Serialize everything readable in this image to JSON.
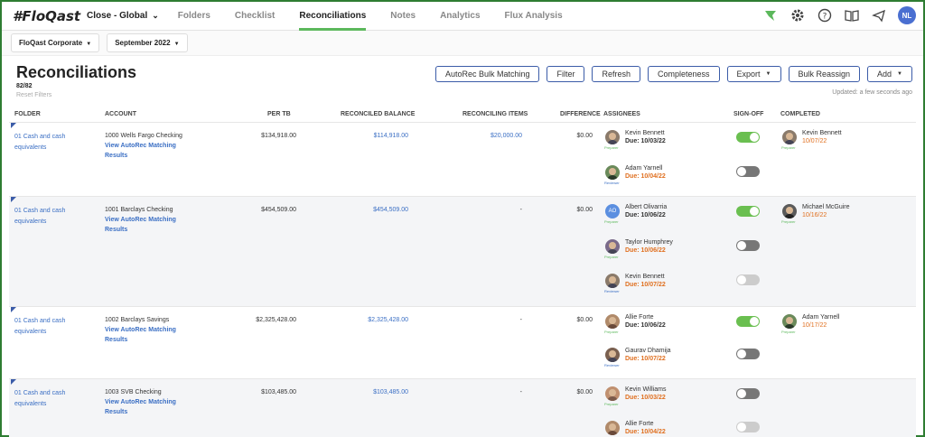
{
  "nav": {
    "logo": "#FloQast",
    "period": "Close - Global",
    "items": [
      "Folders",
      "Checklist",
      "Reconciliations",
      "Notes",
      "Analytics",
      "Flux Analysis"
    ],
    "user_initials": "NL"
  },
  "filters": {
    "entity": "FloQast Corporate",
    "month": "September 2022"
  },
  "page": {
    "title": "Reconciliations",
    "count": "82/82",
    "reset": "Reset Filters",
    "updated": "Updated: a few seconds ago",
    "buttons": [
      "AutoRec Bulk Matching",
      "Filter",
      "Refresh",
      "Completeness",
      "Export",
      "Bulk Reassign",
      "Add"
    ]
  },
  "columns": [
    "FOLDER",
    "ACCOUNT",
    "PER TB",
    "RECONCILED BALANCE",
    "RECONCILING ITEMS",
    "DIFFERENCE",
    "ASSIGNEES",
    "SIGN-OFF",
    "COMPLETED"
  ],
  "link_text": {
    "view": "View AutoRec Matching",
    "results": "Results"
  },
  "rows": [
    {
      "folder_line1": "01 Cash and cash",
      "folder_line2": "equivalents",
      "account": "1000 Wells Fargo Checking",
      "per_tb": "$134,918.00",
      "reconciled": "$114,918.00",
      "reconciling": "$20,000.00",
      "difference": "$0.00",
      "assignees": [
        {
          "name": "Kevin Bennett",
          "due": "Due: 10/03/22",
          "role": "Preparer",
          "signed": true
        },
        {
          "name": "Adam Yarnell",
          "due": "Due: 10/04/22",
          "role": "Reviewer",
          "signed": false
        }
      ],
      "completed": [
        {
          "name": "Kevin Bennett",
          "date": "10/07/22",
          "role": "Preparer"
        }
      ]
    },
    {
      "folder_line1": "01 Cash and cash",
      "folder_line2": "equivalents",
      "account": "1001 Barclays Checking",
      "per_tb": "$454,509.00",
      "reconciled": "$454,509.00",
      "reconciling": "-",
      "difference": "$0.00",
      "assignees": [
        {
          "name": "Albert Olivarria",
          "due": "Due: 10/06/22",
          "role": "Preparer",
          "signed": true,
          "initials": "AO"
        },
        {
          "name": "Taylor Humphrey",
          "due": "Due: 10/06/22",
          "role": "Preparer",
          "signed": false
        },
        {
          "name": "Kevin Bennett",
          "due": "Due: 10/07/22",
          "role": "Reviewer",
          "signed": false
        }
      ],
      "completed": [
        {
          "name": "Michael McGuire",
          "date": "10/16/22",
          "role": "Preparer"
        }
      ]
    },
    {
      "folder_line1": "01 Cash and cash",
      "folder_line2": "equivalents",
      "account": "1002 Barclays Savings",
      "per_tb": "$2,325,428.00",
      "reconciled": "$2,325,428.00",
      "reconciling": "-",
      "difference": "$0.00",
      "assignees": [
        {
          "name": "Allie Forte",
          "due": "Due: 10/06/22",
          "role": "Preparer",
          "signed": true
        },
        {
          "name": "Gaurav Dhamija",
          "due": "Due: 10/07/22",
          "role": "Reviewer",
          "signed": false
        }
      ],
      "completed": [
        {
          "name": "Adam Yarnell",
          "date": "10/17/22",
          "role": "Preparer"
        }
      ]
    },
    {
      "folder_line1": "01 Cash and cash",
      "folder_line2": "equivalents",
      "account": "1003 SVB Checking",
      "per_tb": "$103,485.00",
      "reconciled": "$103,485.00",
      "reconciling": "-",
      "difference": "$0.00",
      "assignees": [
        {
          "name": "Kevin Williams",
          "due": "Due: 10/03/22",
          "role": "Preparer",
          "signed": false
        },
        {
          "name": "Allie Forte",
          "due": "Due: 10/04/22",
          "role": "Reviewer",
          "signed": false
        }
      ],
      "completed": []
    }
  ]
}
